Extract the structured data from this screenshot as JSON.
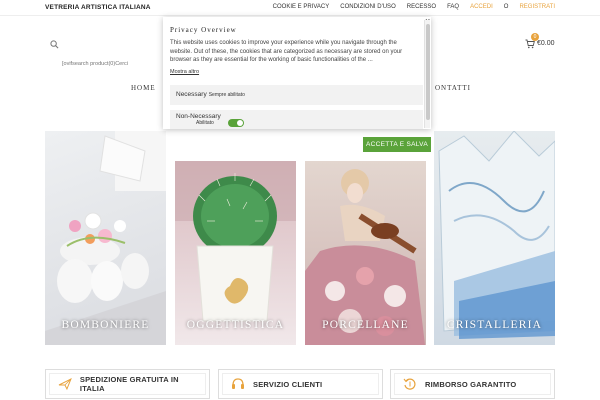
{
  "topbar": {
    "brand": "VETRERIA ARTISTICA ITALIANA",
    "links": {
      "cookie": "COOKIE E PRIVACY",
      "terms": "CONDIZIONI D'USO",
      "recesso": "RECESSO",
      "faq": "FAQ",
      "login": "ACCEDI",
      "or": "O",
      "register": "REGISTRATI"
    }
  },
  "header": {
    "search_placeholder": "[ovifsearch product(0)Cerci",
    "cart_count": "0",
    "cart_total": "€0.00"
  },
  "nav": {
    "home": "HOME",
    "contatti": "ONTATTI"
  },
  "categories": [
    {
      "title": "BOMBONIERE"
    },
    {
      "title": "OGGETTISTICA"
    },
    {
      "title": "PORCELLANE"
    },
    {
      "title": "CRISTALLERIA"
    }
  ],
  "features": [
    {
      "label": "SPEDIZIONE GRATUITA IN ITALIA",
      "icon": "plane-icon"
    },
    {
      "label": "SERVIZIO CLIENTI",
      "icon": "headset-icon"
    },
    {
      "label": "RIMBORSO GARANTITO",
      "icon": "refund-icon"
    }
  ],
  "cookie_modal": {
    "title": "Privacy Overview",
    "close": "×",
    "text": "This website uses cookies to improve your experience while you navigate through the website. Out of these, the cookies that are categorized as necessary are stored on your browser as they are essential for the working of basic functionalities of the ...",
    "more": "Mostra altro",
    "necessary_label": "Necessary",
    "necessary_note": "Sempre abilitato",
    "non_necessary_label": "Non-Necessary",
    "non_necessary_note": "Abilitato",
    "accept_button": "ACCETTA E SALVA"
  },
  "colors": {
    "accent": "#e8a33d",
    "accept_green": "#5aa33a"
  }
}
